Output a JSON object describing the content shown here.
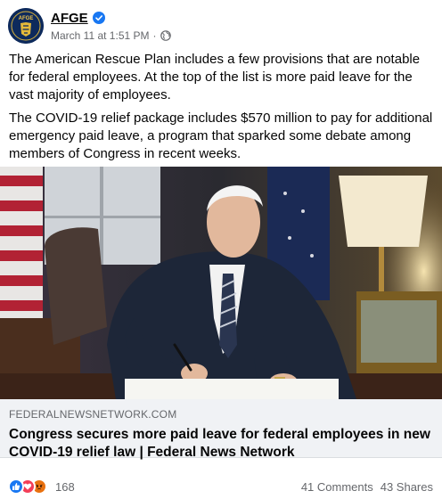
{
  "post": {
    "page_name": "AFGE",
    "timestamp": "March 11 at 1:51 PM",
    "separator": "·",
    "avatar_text": "AFGE",
    "paragraphs": [
      "The American Rescue Plan includes a few provisions that are notable for federal employees. At the top of the list is more paid leave for the vast majority of employees.",
      "The COVID-19 relief package includes $570 million to pay for additional emergency paid leave, a program that sparked some debate among members of Congress in recent weeks."
    ]
  },
  "link_preview": {
    "domain": "FEDERALNEWSNETWORK.COM",
    "title": "Congress secures more paid leave for federal employees in new COVID-19 relief law | Federal News Network"
  },
  "engagement": {
    "reaction_count": "168",
    "comments": "41 Comments",
    "shares": "43 Shares",
    "reactions": [
      "like-icon",
      "love-icon",
      "angry-icon"
    ]
  },
  "colors": {
    "like": "#1877f2",
    "love": "#f33e58",
    "angry": "#e9710f",
    "secondary_text": "#65676b",
    "card_bg": "#f0f2f5"
  }
}
